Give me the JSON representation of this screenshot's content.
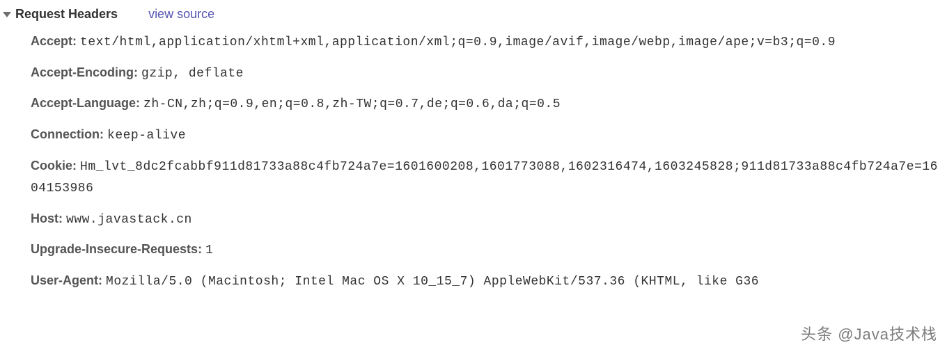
{
  "section": {
    "title": "Request Headers",
    "view_source_label": "view source"
  },
  "headers": [
    {
      "name": "Accept:",
      "value": "text/html,application/xhtml+xml,application/xml;q=0.9,image/avif,image/webp,image/ape;v=b3;q=0.9"
    },
    {
      "name": "Accept-Encoding:",
      "value": "gzip, deflate"
    },
    {
      "name": "Accept-Language:",
      "value": "zh-CN,zh;q=0.9,en;q=0.8,zh-TW;q=0.7,de;q=0.6,da;q=0.5"
    },
    {
      "name": "Connection:",
      "value": "keep-alive"
    },
    {
      "name": "Cookie:",
      "value": "Hm_lvt_8dc2fcabbf911d81733a88c4fb724a7e=1601600208,1601773088,1602316474,1603245828;911d81733a88c4fb724a7e=1604153986"
    },
    {
      "name": "Host:",
      "value": "www.javastack.cn"
    },
    {
      "name": "Upgrade-Insecure-Requests:",
      "value": "1"
    },
    {
      "name": "User-Agent:",
      "value": "Mozilla/5.0 (Macintosh; Intel Mac OS X 10_15_7) AppleWebKit/537.36 (KHTML, like G36"
    }
  ],
  "watermark": "头条 @Java技术栈"
}
